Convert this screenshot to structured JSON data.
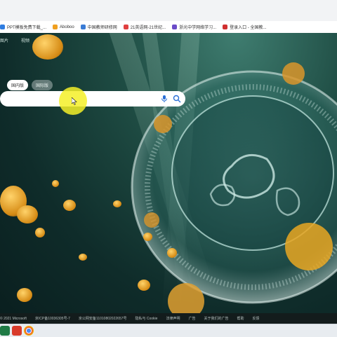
{
  "bookmarks": [
    {
      "label": "PPT模板免费下载_...",
      "icon": "doc-icon",
      "color": "#2f7de1"
    },
    {
      "label": "Aboboo",
      "icon": "aboboo-icon",
      "color": "#f0a020"
    },
    {
      "label": "中国教师研修网",
      "icon": "teacher-icon",
      "color": "#3a7bd5"
    },
    {
      "label": "21英语网-21世纪...",
      "icon": "english-icon",
      "color": "#e04040"
    },
    {
      "label": "浙光中学网络学习...",
      "icon": "school-icon",
      "color": "#6b4bc8"
    },
    {
      "label": "登录入口 - 全国教...",
      "icon": "login-icon",
      "color": "#d03030"
    }
  ],
  "nav": [
    "图片",
    "视频"
  ],
  "tabs": [
    "国内版",
    "国际版"
  ],
  "footer": [
    "© 2021 Microsoft",
    "京ICP备10036305号-7",
    "京公网安备11010802022657号",
    "隐私与 Cookie",
    "法律声明",
    "广告",
    "关于我们的广告",
    "帮助",
    "反馈"
  ]
}
